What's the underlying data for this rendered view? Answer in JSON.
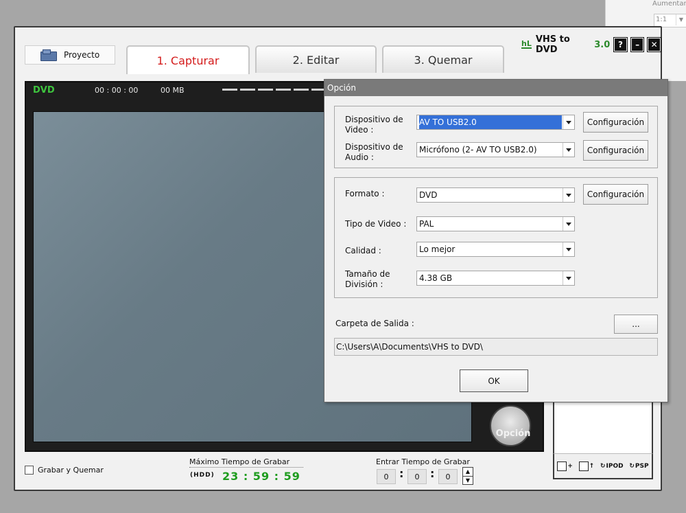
{
  "background_window": {
    "label": "Aumentar",
    "zoom_value": "1:1"
  },
  "app": {
    "project_button": "Proyecto",
    "tabs": [
      {
        "label": "1. Capturar",
        "active": true
      },
      {
        "label": "2. Editar",
        "active": false
      },
      {
        "label": "3. Quemar",
        "active": false
      }
    ],
    "brand": {
      "logo": "hL",
      "name": "VHS to DVD",
      "version": "3.0"
    },
    "window_buttons": {
      "help": "?",
      "minimize": "–",
      "close": "✕"
    },
    "video": {
      "format_label": "DVD",
      "time": "00 : 00 : 00",
      "size": "00 MB",
      "option_button": "Opción"
    },
    "right_panel_icons": {
      "ipod": "IPOD",
      "psp": "PSP"
    },
    "bottom": {
      "grabar_quemar": "Grabar y Quemar",
      "max_time_label": "Máximo Tiempo de Grabar",
      "hdd_label": "(HDD)",
      "max_time": "23 : 59 : 59",
      "enter_time_label": "Entrar Tiempo de Grabar",
      "time_fields": [
        "0",
        "0",
        "0"
      ]
    }
  },
  "dialog": {
    "title": "Opción",
    "video_device_label": "Dispositivo de Video :",
    "video_device_value": "AV TO USB2.0",
    "audio_device_label": "Dispositivo de Audio :",
    "audio_device_value": "Micrófono (2- AV TO USB2.0)",
    "config_button": "Configuración",
    "format_label": "Formato :",
    "format_value": "DVD",
    "video_type_label": "Tipo de Video :",
    "video_type_value": "PAL",
    "quality_label": "Calidad :",
    "quality_value": "Lo mejor",
    "split_size_label": "Tamaño de División :",
    "split_size_value": "4.38 GB",
    "output_folder_label": "Carpeta de Salida :",
    "browse_button": "...",
    "output_path": "C:\\Users\\A\\Documents\\VHS to DVD\\",
    "ok_button": "OK"
  }
}
